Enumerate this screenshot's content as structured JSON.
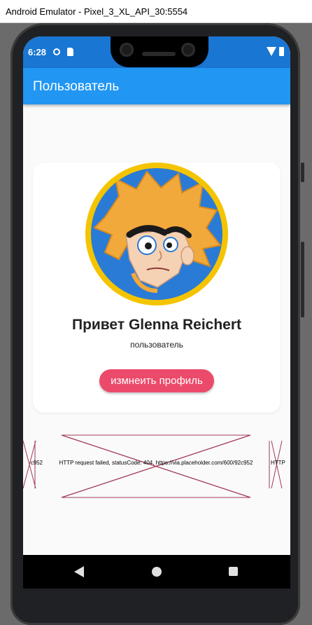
{
  "window": {
    "title": "Android Emulator - Pixel_3_XL_API_30:5554"
  },
  "status_bar": {
    "time": "6:28",
    "icons": [
      "data-saver-icon",
      "sd-card-icon",
      "wifi-icon",
      "battery-icon"
    ]
  },
  "app_bar": {
    "title": "Пользователь"
  },
  "profile": {
    "greeting": "Привет Glenna Reichert",
    "role": "пользователь",
    "edit_button_label": "измнеить профиль"
  },
  "carousel": {
    "items": [
      {
        "error_text": "c952"
      },
      {
        "error_text": "HTTP request failed, statusCode: 404, https://via.placeholder.com/600/92c952"
      },
      {
        "error_text": "HTTP"
      }
    ]
  },
  "nav_bar": {
    "icons": [
      "back-icon",
      "home-icon",
      "recents-icon"
    ]
  },
  "colors": {
    "status_bar": "#1976d2",
    "app_bar": "#2196f3",
    "button": "#ec4a6a",
    "avatar_ring": "#f5c400",
    "error_lines": "#a33a55"
  }
}
